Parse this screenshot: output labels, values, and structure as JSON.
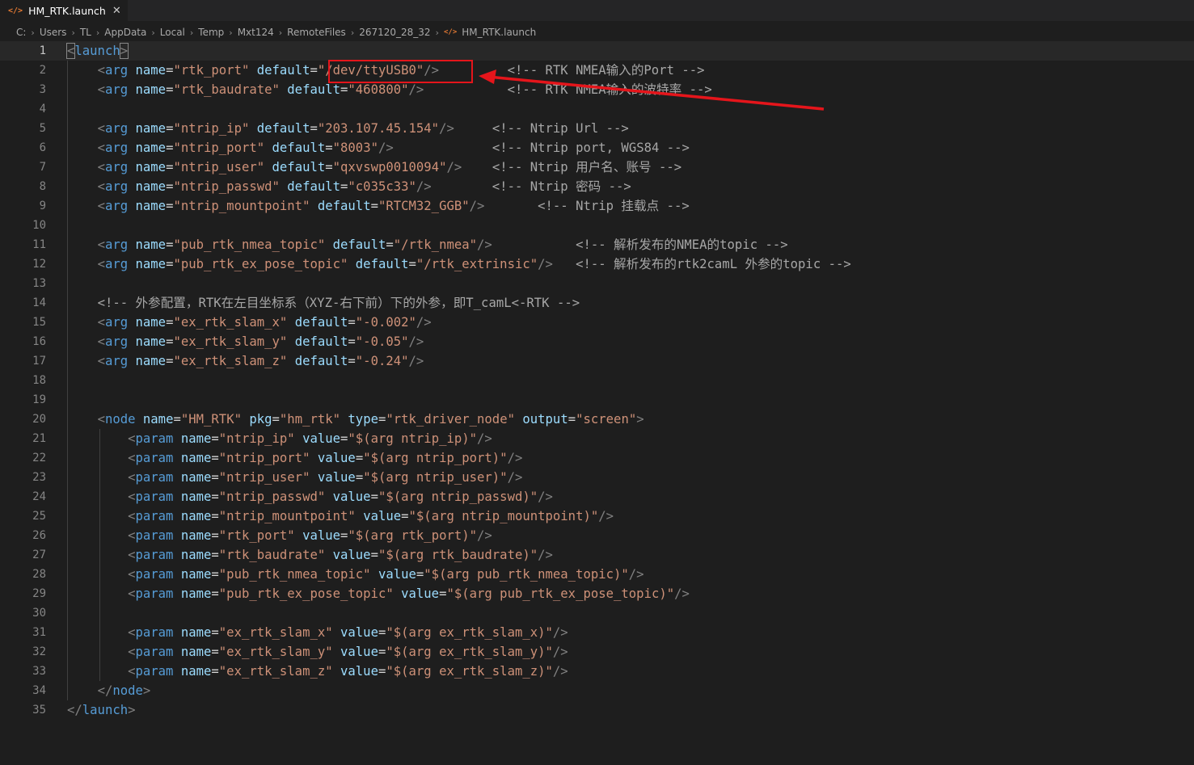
{
  "tab": {
    "icon": "xml-icon",
    "label": "HM_RTK.launch",
    "close": "✕"
  },
  "breadcrumb": [
    "C:",
    "Users",
    "TL",
    "AppData",
    "Local",
    "Temp",
    "Mxt124",
    "RemoteFiles",
    "267120_28_32",
    "HM_RTK.launch"
  ],
  "colors": {
    "tag": "#569cd6",
    "attr": "#9cdcfe",
    "string": "#ce9178",
    "comment": "#a7a7a7",
    "annotation": "#e5151b"
  },
  "annotation": {
    "type": "red-box-and-arrow",
    "target": "/dev/ttyUSB0"
  },
  "lines": [
    "<launch>",
    "    <arg name=\"rtk_port\" default=\"/dev/ttyUSB0\"/>         <!-- RTK NMEA输入的Port -->",
    "    <arg name=\"rtk_baudrate\" default=\"460800\"/>           <!-- RTK NMEA输入的波特率 -->",
    "",
    "    <arg name=\"ntrip_ip\" default=\"203.107.45.154\"/>     <!-- Ntrip Url -->",
    "    <arg name=\"ntrip_port\" default=\"8003\"/>             <!-- Ntrip port, WGS84 -->",
    "    <arg name=\"ntrip_user\" default=\"qxvswp0010094\"/>    <!-- Ntrip 用户名、账号 -->",
    "    <arg name=\"ntrip_passwd\" default=\"c035c33\"/>        <!-- Ntrip 密码 -->",
    "    <arg name=\"ntrip_mountpoint\" default=\"RTCM32_GGB\"/>       <!-- Ntrip 挂载点 -->",
    "",
    "    <arg name=\"pub_rtk_nmea_topic\" default=\"/rtk_nmea\"/>           <!-- 解析发布的NMEA的topic -->",
    "    <arg name=\"pub_rtk_ex_pose_topic\" default=\"/rtk_extrinsic\"/>   <!-- 解析发布的rtk2camL 外参的topic -->",
    "",
    "    <!-- 外参配置，RTK在左目坐标系（XYZ-右下前）下的外参，即T_camL<-RTK -->",
    "    <arg name=\"ex_rtk_slam_x\" default=\"-0.002\"/>",
    "    <arg name=\"ex_rtk_slam_y\" default=\"-0.05\"/>",
    "    <arg name=\"ex_rtk_slam_z\" default=\"-0.24\"/>",
    "",
    "",
    "    <node name=\"HM_RTK\" pkg=\"hm_rtk\" type=\"rtk_driver_node\" output=\"screen\">",
    "        <param name=\"ntrip_ip\" value=\"$(arg ntrip_ip)\"/>",
    "        <param name=\"ntrip_port\" value=\"$(arg ntrip_port)\"/>",
    "        <param name=\"ntrip_user\" value=\"$(arg ntrip_user)\"/>",
    "        <param name=\"ntrip_passwd\" value=\"$(arg ntrip_passwd)\"/>",
    "        <param name=\"ntrip_mountpoint\" value=\"$(arg ntrip_mountpoint)\"/>",
    "        <param name=\"rtk_port\" value=\"$(arg rtk_port)\"/>",
    "        <param name=\"rtk_baudrate\" value=\"$(arg rtk_baudrate)\"/>",
    "        <param name=\"pub_rtk_nmea_topic\" value=\"$(arg pub_rtk_nmea_topic)\"/>",
    "        <param name=\"pub_rtk_ex_pose_topic\" value=\"$(arg pub_rtk_ex_pose_topic)\"/>",
    "",
    "        <param name=\"ex_rtk_slam_x\" value=\"$(arg ex_rtk_slam_x)\"/>",
    "        <param name=\"ex_rtk_slam_y\" value=\"$(arg ex_rtk_slam_y)\"/>",
    "        <param name=\"ex_rtk_slam_z\" value=\"$(arg ex_rtk_slam_z)\"/>",
    "    </node>",
    "</launch>"
  ]
}
